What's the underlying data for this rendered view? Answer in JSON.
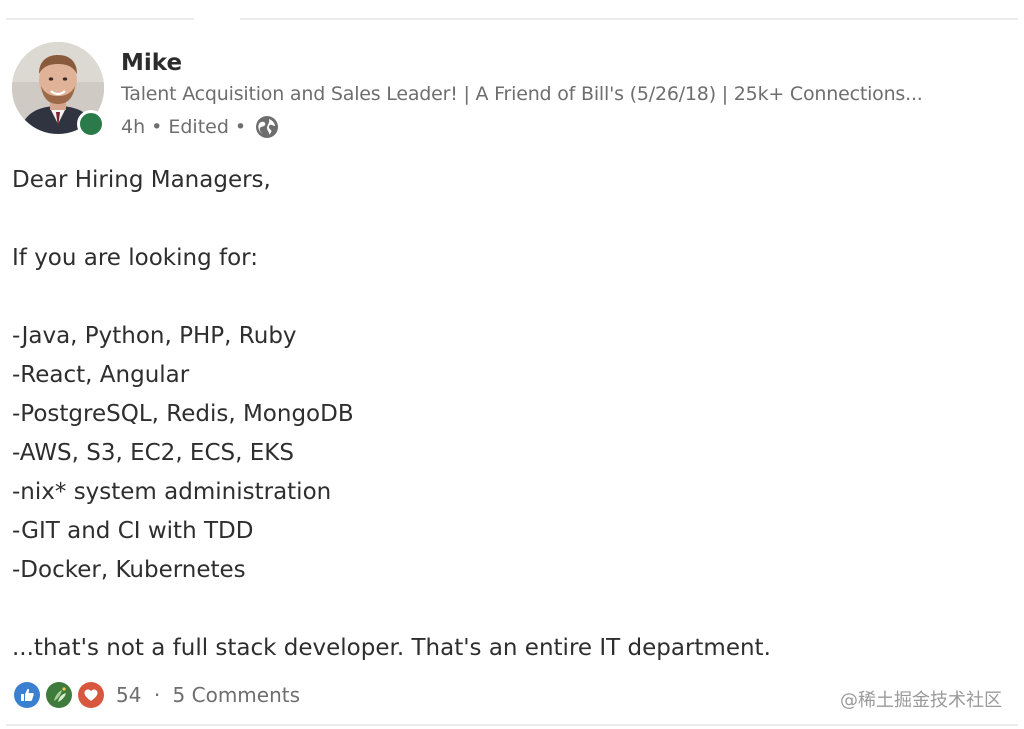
{
  "post": {
    "author": {
      "name": "Mike",
      "headline": "Talent Acquisition and Sales Leader! | A Friend of Bill's (5/26/18) | 25k+ Connections...",
      "online": true,
      "status_color": "#2b7a4a"
    },
    "meta": {
      "time": "4h",
      "edited": "Edited",
      "separator": "•",
      "visibility_icon": "globe-icon"
    },
    "body": {
      "greeting": "Dear Hiring Managers,",
      "intro": "If you are looking for:",
      "items": [
        "-Java, Python, PHP, Ruby",
        "-React, Angular",
        "-PostgreSQL, Redis, MongoDB",
        "-AWS, S3, EC2, ECS, EKS",
        "-nix* system administration",
        "-GIT and CI with TDD",
        "-Docker, Kubernetes"
      ],
      "conclusion": "...that's not a full stack developer. That's an entire IT department."
    },
    "social": {
      "reaction_icons": [
        "like-icon",
        "celebrate-icon",
        "love-icon"
      ],
      "reaction_count": "54",
      "separator": "·",
      "comments": "5 Comments"
    }
  },
  "watermark": "@稀土掘金技术社区",
  "colors": {
    "like": "#3b7fd0",
    "celebrate": "#3f7b3c",
    "love": "#d8583f",
    "text_secondary": "#6e6e6e"
  }
}
